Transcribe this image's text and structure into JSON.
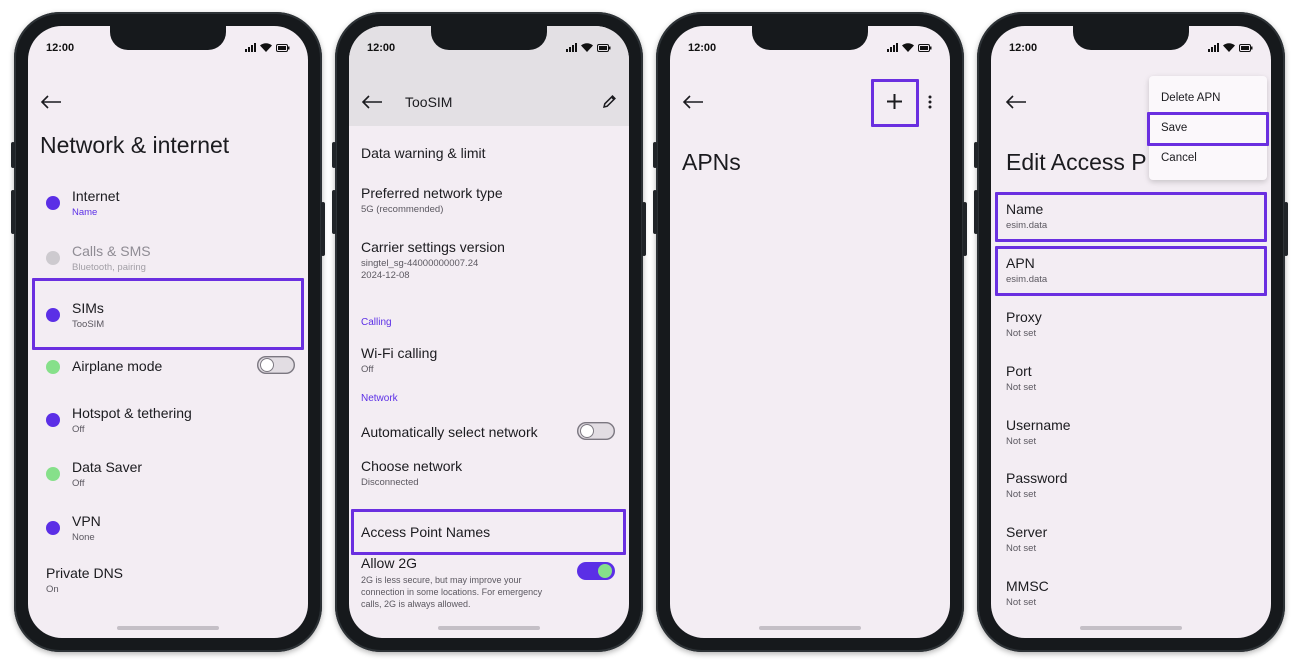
{
  "colors": {
    "accent": "#5b2fe6",
    "highlight": "#6a2fe0",
    "green": "#86e08a",
    "screen_bg": "#f3edf3"
  },
  "status_bar": {
    "time": "12:00",
    "icons": [
      "signal-icon",
      "wifi-icon",
      "battery-icon"
    ]
  },
  "screen1": {
    "back_icon": "arrow-left-icon",
    "title": "Network & internet",
    "items": [
      {
        "title": "Internet",
        "subtitle": "Name",
        "dot": "purple"
      },
      {
        "title": "Calls & SMS",
        "subtitle": "Bluetooth, pairing",
        "dot": "grey"
      },
      {
        "title": "SIMs",
        "subtitle": "TooSIM",
        "dot": "purple"
      },
      {
        "title": "Airplane mode",
        "subtitle": "",
        "dot": "green",
        "toggle": "off"
      },
      {
        "title": "Hotspot & tethering",
        "subtitle": "Off",
        "dot": "purple"
      },
      {
        "title": "Data Saver",
        "subtitle": "Off",
        "dot": "green"
      },
      {
        "title": "VPN",
        "subtitle": "None",
        "dot": "purple"
      }
    ],
    "private_dns": {
      "title": "Private DNS",
      "subtitle": "On"
    }
  },
  "screen2": {
    "title": "TooSIM",
    "edit_icon": "pencil-icon",
    "items": {
      "data_warning": "Data warning & limit",
      "preferred_type": {
        "title": "Preferred network type",
        "subtitle": "5G (recommended)"
      },
      "carrier_version": {
        "title": "Carrier settings version",
        "line1": "singtel_sg-44000000007.24",
        "line2": "2024-12-08"
      },
      "calling_section": "Calling",
      "wifi_calling": {
        "title": "Wi-Fi calling",
        "subtitle": "Off"
      },
      "network_section": "Network",
      "auto_select": {
        "title": "Automatically select network",
        "toggle": "off"
      },
      "choose_network": {
        "title": "Choose network",
        "subtitle": "Disconnected"
      },
      "apn": "Access Point Names",
      "allow_2g": {
        "title": "Allow 2G",
        "line1": "2G is less secure, but may improve your",
        "line2": "connection in some locations. For emergency",
        "line3": "calls, 2G is always allowed.",
        "toggle": "on"
      }
    }
  },
  "screen3": {
    "title": "APNs",
    "add_icon": "plus-icon",
    "more_icon": "more-vert-icon"
  },
  "screen4": {
    "title": "Edit Access P",
    "menu": {
      "delete": "Delete APN",
      "save": "Save",
      "cancel": "Cancel"
    },
    "fields": [
      {
        "label": "Name",
        "value": "esim.data"
      },
      {
        "label": "APN",
        "value": "esim.data"
      },
      {
        "label": "Proxy",
        "value": "Not set"
      },
      {
        "label": "Port",
        "value": "Not set"
      },
      {
        "label": "Username",
        "value": "Not set"
      },
      {
        "label": "Password",
        "value": "Not set"
      },
      {
        "label": "Server",
        "value": "Not set"
      },
      {
        "label": "MMSC",
        "value": "Not set"
      }
    ]
  }
}
